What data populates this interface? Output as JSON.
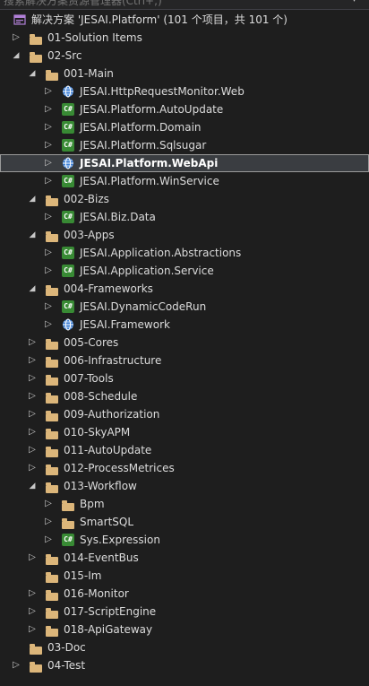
{
  "search": {
    "placeholder": "搜索解决方案资源管理器(Ctrl+;)"
  },
  "solution_label": "解决方案 'JESAI.Platform' (101 个项目，共 101 个)",
  "tree": [
    {
      "name": "solution-root",
      "label_key": "solution_label",
      "depth": 0,
      "type": "solution",
      "chevron": "none"
    },
    {
      "name": "folder-01-solution-items",
      "label": "01-Solution Items",
      "depth": 0,
      "type": "folder",
      "chevron": "collapsed"
    },
    {
      "name": "folder-02-src",
      "label": "02-Src",
      "depth": 0,
      "type": "folder",
      "chevron": "expanded"
    },
    {
      "name": "folder-001-main",
      "label": "001-Main",
      "depth": 1,
      "type": "folder",
      "chevron": "expanded"
    },
    {
      "name": "project-httprequestmonitor-web",
      "label": "JESAI.HttpRequestMonitor.Web",
      "depth": 2,
      "type": "web",
      "chevron": "collapsed"
    },
    {
      "name": "project-platform-autoupdate",
      "label": "JESAI.Platform.AutoUpdate",
      "depth": 2,
      "type": "cs",
      "chevron": "collapsed"
    },
    {
      "name": "project-platform-domain",
      "label": "JESAI.Platform.Domain",
      "depth": 2,
      "type": "cs",
      "chevron": "collapsed"
    },
    {
      "name": "project-platform-sqlsugar",
      "label": "JESAI.Platform.Sqlsugar",
      "depth": 2,
      "type": "cs",
      "chevron": "collapsed"
    },
    {
      "name": "project-platform-webapi",
      "label": "JESAI.Platform.WebApi",
      "depth": 2,
      "type": "web",
      "chevron": "collapsed",
      "selected": true
    },
    {
      "name": "project-platform-winservice",
      "label": "JESAI.Platform.WinService",
      "depth": 2,
      "type": "cs",
      "chevron": "collapsed"
    },
    {
      "name": "folder-002-bizs",
      "label": "002-Bizs",
      "depth": 1,
      "type": "folder",
      "chevron": "expanded"
    },
    {
      "name": "project-biz-data",
      "label": "JESAI.Biz.Data",
      "depth": 2,
      "type": "cs",
      "chevron": "collapsed"
    },
    {
      "name": "folder-003-apps",
      "label": "003-Apps",
      "depth": 1,
      "type": "folder",
      "chevron": "expanded"
    },
    {
      "name": "project-application-abstractions",
      "label": "JESAI.Application.Abstractions",
      "depth": 2,
      "type": "cs",
      "chevron": "collapsed"
    },
    {
      "name": "project-application-service",
      "label": "JESAI.Application.Service",
      "depth": 2,
      "type": "cs",
      "chevron": "collapsed"
    },
    {
      "name": "folder-004-frameworks",
      "label": "004-Frameworks",
      "depth": 1,
      "type": "folder",
      "chevron": "expanded"
    },
    {
      "name": "project-dynamiccoderun",
      "label": "JESAI.DynamicCodeRun",
      "depth": 2,
      "type": "cs",
      "chevron": "collapsed"
    },
    {
      "name": "project-framework",
      "label": "JESAI.Framework",
      "depth": 2,
      "type": "web",
      "chevron": "collapsed"
    },
    {
      "name": "folder-005-cores",
      "label": "005-Cores",
      "depth": 1,
      "type": "folder",
      "chevron": "collapsed"
    },
    {
      "name": "folder-006-infrastructure",
      "label": "006-Infrastructure",
      "depth": 1,
      "type": "folder",
      "chevron": "collapsed"
    },
    {
      "name": "folder-007-tools",
      "label": "007-Tools",
      "depth": 1,
      "type": "folder",
      "chevron": "collapsed"
    },
    {
      "name": "folder-008-schedule",
      "label": "008-Schedule",
      "depth": 1,
      "type": "folder",
      "chevron": "collapsed"
    },
    {
      "name": "folder-009-authorization",
      "label": "009-Authorization",
      "depth": 1,
      "type": "folder",
      "chevron": "collapsed"
    },
    {
      "name": "folder-010-skyapm",
      "label": "010-SkyAPM",
      "depth": 1,
      "type": "folder",
      "chevron": "collapsed"
    },
    {
      "name": "folder-011-autoupdate",
      "label": "011-AutoUpdate",
      "depth": 1,
      "type": "folder",
      "chevron": "collapsed"
    },
    {
      "name": "folder-012-processmetrices",
      "label": "012-ProcessMetrices",
      "depth": 1,
      "type": "folder",
      "chevron": "collapsed"
    },
    {
      "name": "folder-013-workflow",
      "label": "013-Workflow",
      "depth": 1,
      "type": "folder",
      "chevron": "expanded"
    },
    {
      "name": "folder-bpm",
      "label": "Bpm",
      "depth": 2,
      "type": "folder",
      "chevron": "collapsed"
    },
    {
      "name": "folder-smartsql",
      "label": "SmartSQL",
      "depth": 2,
      "type": "folder",
      "chevron": "collapsed"
    },
    {
      "name": "project-sys-expression",
      "label": "Sys.Expression",
      "depth": 2,
      "type": "cs",
      "chevron": "collapsed"
    },
    {
      "name": "folder-014-eventbus",
      "label": "014-EventBus",
      "depth": 1,
      "type": "folder",
      "chevron": "collapsed"
    },
    {
      "name": "folder-015-im",
      "label": "015-Im",
      "depth": 1,
      "type": "folder",
      "chevron": "none"
    },
    {
      "name": "folder-016-monitor",
      "label": "016-Monitor",
      "depth": 1,
      "type": "folder",
      "chevron": "collapsed"
    },
    {
      "name": "folder-017-scriptengine",
      "label": "017-ScriptEngine",
      "depth": 1,
      "type": "folder",
      "chevron": "collapsed"
    },
    {
      "name": "folder-018-apigateway",
      "label": "018-ApiGateway",
      "depth": 1,
      "type": "folder",
      "chevron": "collapsed"
    },
    {
      "name": "folder-03-doc",
      "label": "03-Doc",
      "depth": 0,
      "type": "folder",
      "chevron": "none"
    },
    {
      "name": "folder-04-test",
      "label": "04-Test",
      "depth": 0,
      "type": "folder",
      "chevron": "collapsed"
    }
  ],
  "colors": {
    "folder": "#dcb67a",
    "csharp": "#388a34",
    "web": "#3c7fd6",
    "selection": "#3a3d41"
  }
}
